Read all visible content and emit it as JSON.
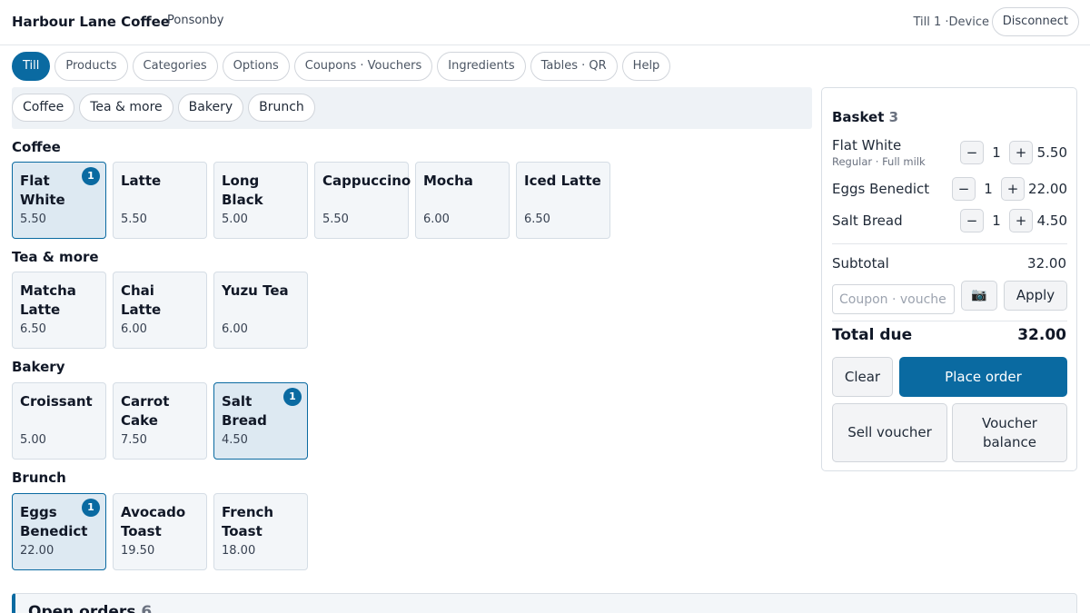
{
  "header": {
    "brand": "Harbour Lane Coffee",
    "location": "Ponsonby",
    "device": "Till 1 ·Device",
    "disconnect_label": "Disconnect"
  },
  "nav": {
    "tabs": [
      {
        "label": "Till",
        "active": true
      },
      {
        "label": "Products"
      },
      {
        "label": "Categories"
      },
      {
        "label": "Options"
      },
      {
        "label": "Coupons · Vouchers"
      },
      {
        "label": "Ingredients"
      },
      {
        "label": "Tables · QR"
      },
      {
        "label": "Help"
      }
    ]
  },
  "categories": {
    "pills": [
      "Coffee",
      "Tea & more",
      "Bakery",
      "Brunch"
    ]
  },
  "sections": [
    {
      "title": "Coffee",
      "items": [
        {
          "name": "Flat White",
          "price": "5.50",
          "badge": "1"
        },
        {
          "name": "Latte",
          "price": "5.50"
        },
        {
          "name": "Long Black",
          "price": "5.00"
        },
        {
          "name": "Cappuccino",
          "price": "5.50"
        },
        {
          "name": "Mocha",
          "price": "6.00"
        },
        {
          "name": "Iced Latte",
          "price": "6.50"
        }
      ]
    },
    {
      "title": "Tea & more",
      "items": [
        {
          "name": "Matcha Latte",
          "price": "6.50"
        },
        {
          "name": "Chai Latte",
          "price": "6.00"
        },
        {
          "name": "Yuzu Tea",
          "price": "6.00"
        }
      ]
    },
    {
      "title": "Bakery",
      "items": [
        {
          "name": "Croissant",
          "price": "5.00"
        },
        {
          "name": "Carrot Cake",
          "price": "7.50"
        },
        {
          "name": "Salt Bread",
          "price": "4.50",
          "badge": "1"
        }
      ]
    },
    {
      "title": "Brunch",
      "items": [
        {
          "name": "Eggs Benedict",
          "price": "22.00",
          "badge": "1"
        },
        {
          "name": "Avocado Toast",
          "price": "19.50"
        },
        {
          "name": "French Toast",
          "price": "18.00"
        }
      ]
    }
  ],
  "basket": {
    "title": "Basket",
    "count": "3",
    "lines": [
      {
        "name": "Flat White",
        "modifiers": "Regular · Full milk",
        "qty": "1",
        "price": "5.50"
      },
      {
        "name": "Eggs Benedict",
        "modifiers": "",
        "qty": "1",
        "price": "22.00"
      },
      {
        "name": "Salt Bread",
        "modifiers": "",
        "qty": "1",
        "price": "4.50"
      }
    ],
    "minus_symbol": "−",
    "plus_symbol": "+",
    "subtotal_label": "Subtotal",
    "subtotal": "32.00",
    "coupon_placeholder": "Coupon · voucher",
    "camera_icon": "camera-icon",
    "camera_glyph": "📷",
    "apply_label": "Apply",
    "total_label": "Total due",
    "total": "32.00",
    "clear_label": "Clear",
    "place_order_label": "Place order",
    "sell_voucher_label": "Sell voucher",
    "voucher_balance_label": "Voucher balance"
  },
  "open_orders": {
    "title": "Open orders",
    "count": "6"
  },
  "colors": {
    "accent": "#0a6aa1",
    "card_bg": "#f3f6f9",
    "card_selected_bg": "#dde9f2"
  }
}
